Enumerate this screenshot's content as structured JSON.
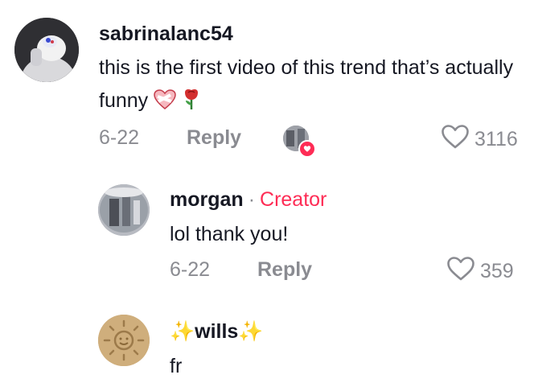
{
  "comments": [
    {
      "username": "sabrinalanc54",
      "text": "this is the first video of this trend that’s actually funny",
      "emoji": [
        "mending-heart-emoji",
        "rose-emoji"
      ],
      "date": "6-22",
      "reply_label": "Reply",
      "likes": "3116",
      "liked_by_creator": true
    },
    {
      "username": "morgan",
      "separator": "·",
      "badge": "Creator",
      "text": "lol thank you!",
      "date": "6-22",
      "reply_label": "Reply",
      "likes": "359"
    },
    {
      "username": "✨wills✨",
      "text": "fr"
    }
  ],
  "colors": {
    "text": "#161823",
    "meta": "#8a8b91",
    "creator": "#fe2c55",
    "heart_badge": "#fe2c55"
  }
}
